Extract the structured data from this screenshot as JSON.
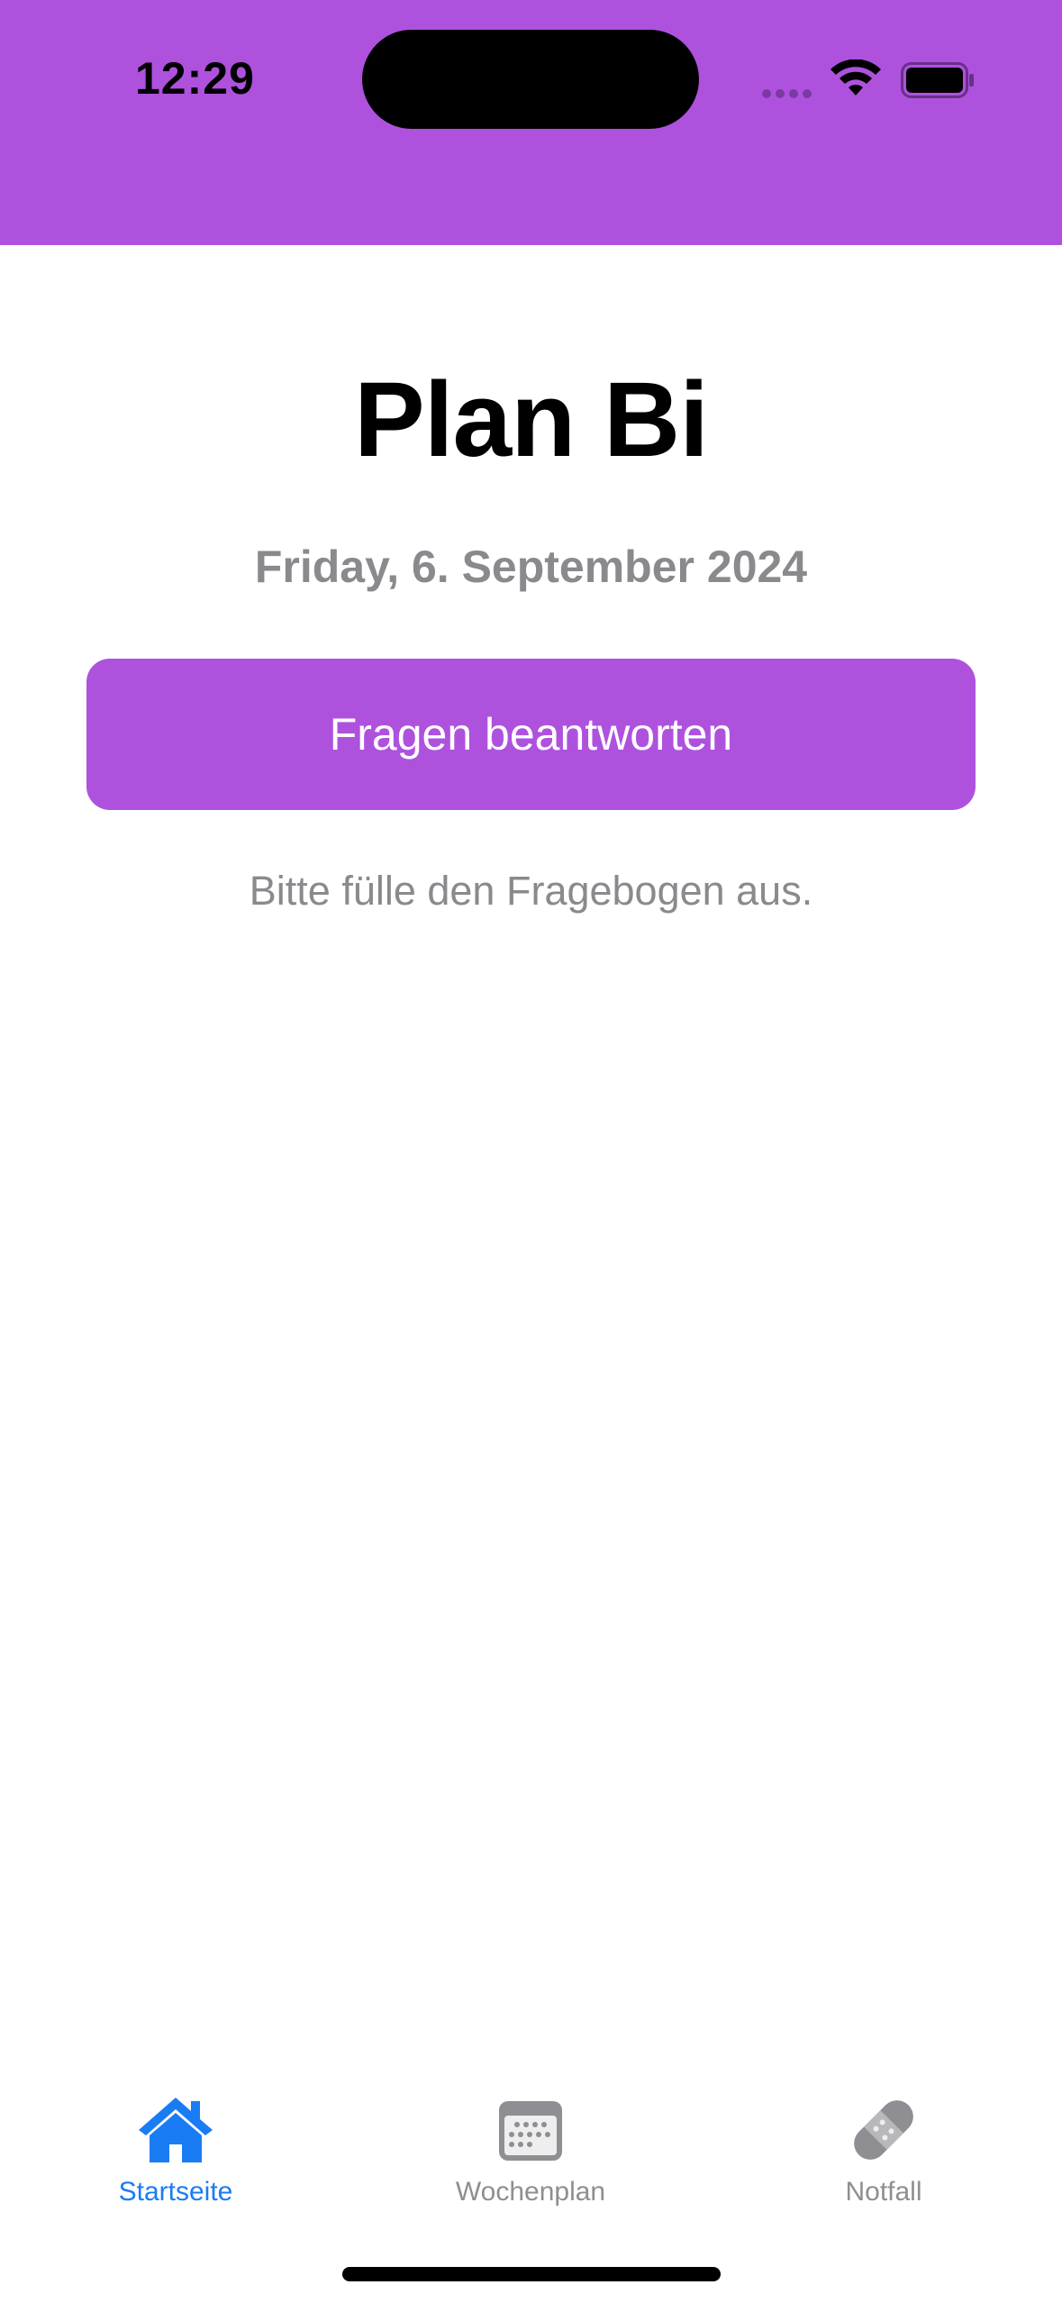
{
  "status_bar": {
    "time": "12:29",
    "icons": [
      "cellular-signal-icon",
      "wifi-icon",
      "battery-icon"
    ]
  },
  "header": {
    "background_color": "#AE52DE"
  },
  "main": {
    "title": "Plan Bi",
    "date": "Friday, 6. September 2024",
    "primary_button_label": "Fragen beantworten",
    "hint": "Bitte fülle den Fragebogen aus."
  },
  "tab_bar": {
    "active_color": "#1a7cf5",
    "inactive_color": "#8e8e93",
    "items": [
      {
        "label": "Startseite",
        "icon": "house-icon",
        "active": true
      },
      {
        "label": "Wochenplan",
        "icon": "calendar-icon",
        "active": false
      },
      {
        "label": "Notfall",
        "icon": "bandage-icon",
        "active": false
      }
    ]
  }
}
